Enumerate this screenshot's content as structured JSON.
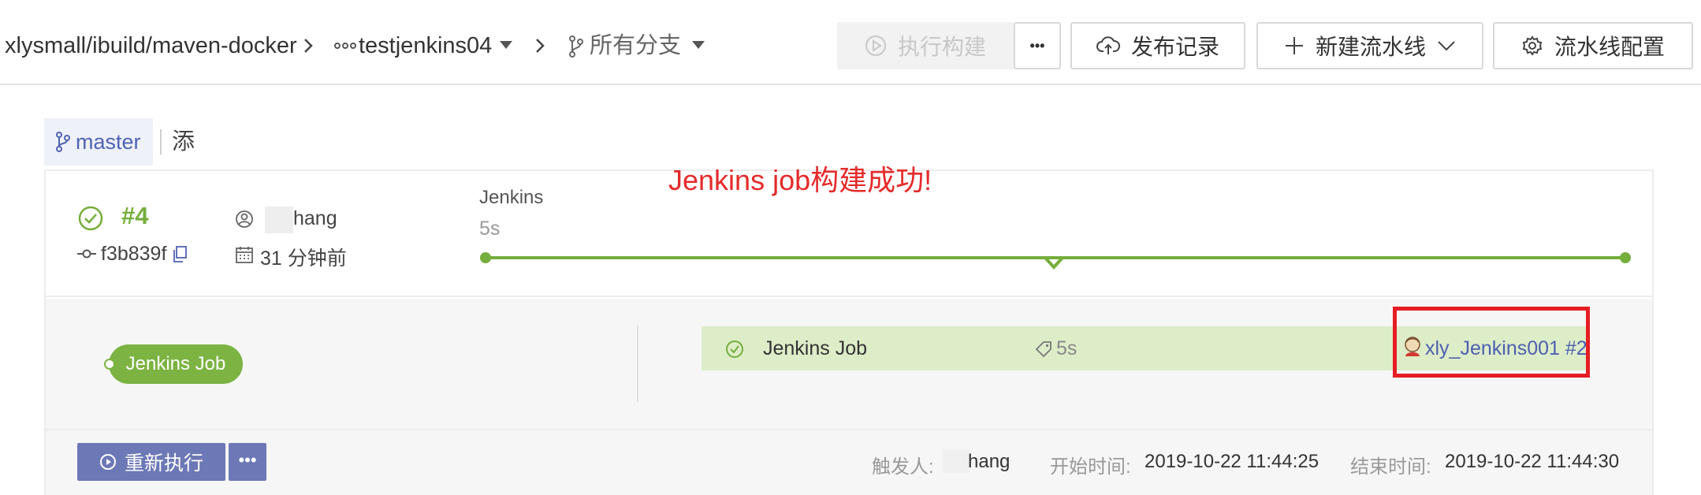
{
  "breadcrumb": {
    "repo": "xlysmall/ibuild/maven-docker",
    "pipeline": "testjenkins04",
    "branch_filter": "所有分支"
  },
  "toolbar": {
    "run_build": "执行构建",
    "more": "•••",
    "release_history": "发布记录",
    "new_pipeline": "新建流水线",
    "pipeline_config": "流水线配置"
  },
  "build": {
    "branch": "master",
    "add_note": "添加备注",
    "number": "#4",
    "commit": "f3b839f",
    "user": "hang",
    "time_ago": "31 分钟前",
    "annotation": "Jenkins job构建成功!"
  },
  "stage": {
    "name": "Jenkins",
    "duration": "5s"
  },
  "job": {
    "pill_label": "Jenkins Job",
    "name": "Jenkins Job",
    "duration": "5s",
    "link": "xly_Jenkins001 #2"
  },
  "footer": {
    "rerun": "重新执行",
    "more": "•••",
    "trigger_label": "触发人:",
    "trigger_value": "hang",
    "start_label": "开始时间:",
    "start_value": "2019-10-22 11:44:25",
    "end_label": "结束时间:",
    "end_value": "2019-10-22 11:44:30"
  },
  "colors": {
    "success": "#75ae3c",
    "primary": "#6d78b6",
    "annotation": "#e52a2a",
    "highlight_box": "#e61d23"
  }
}
